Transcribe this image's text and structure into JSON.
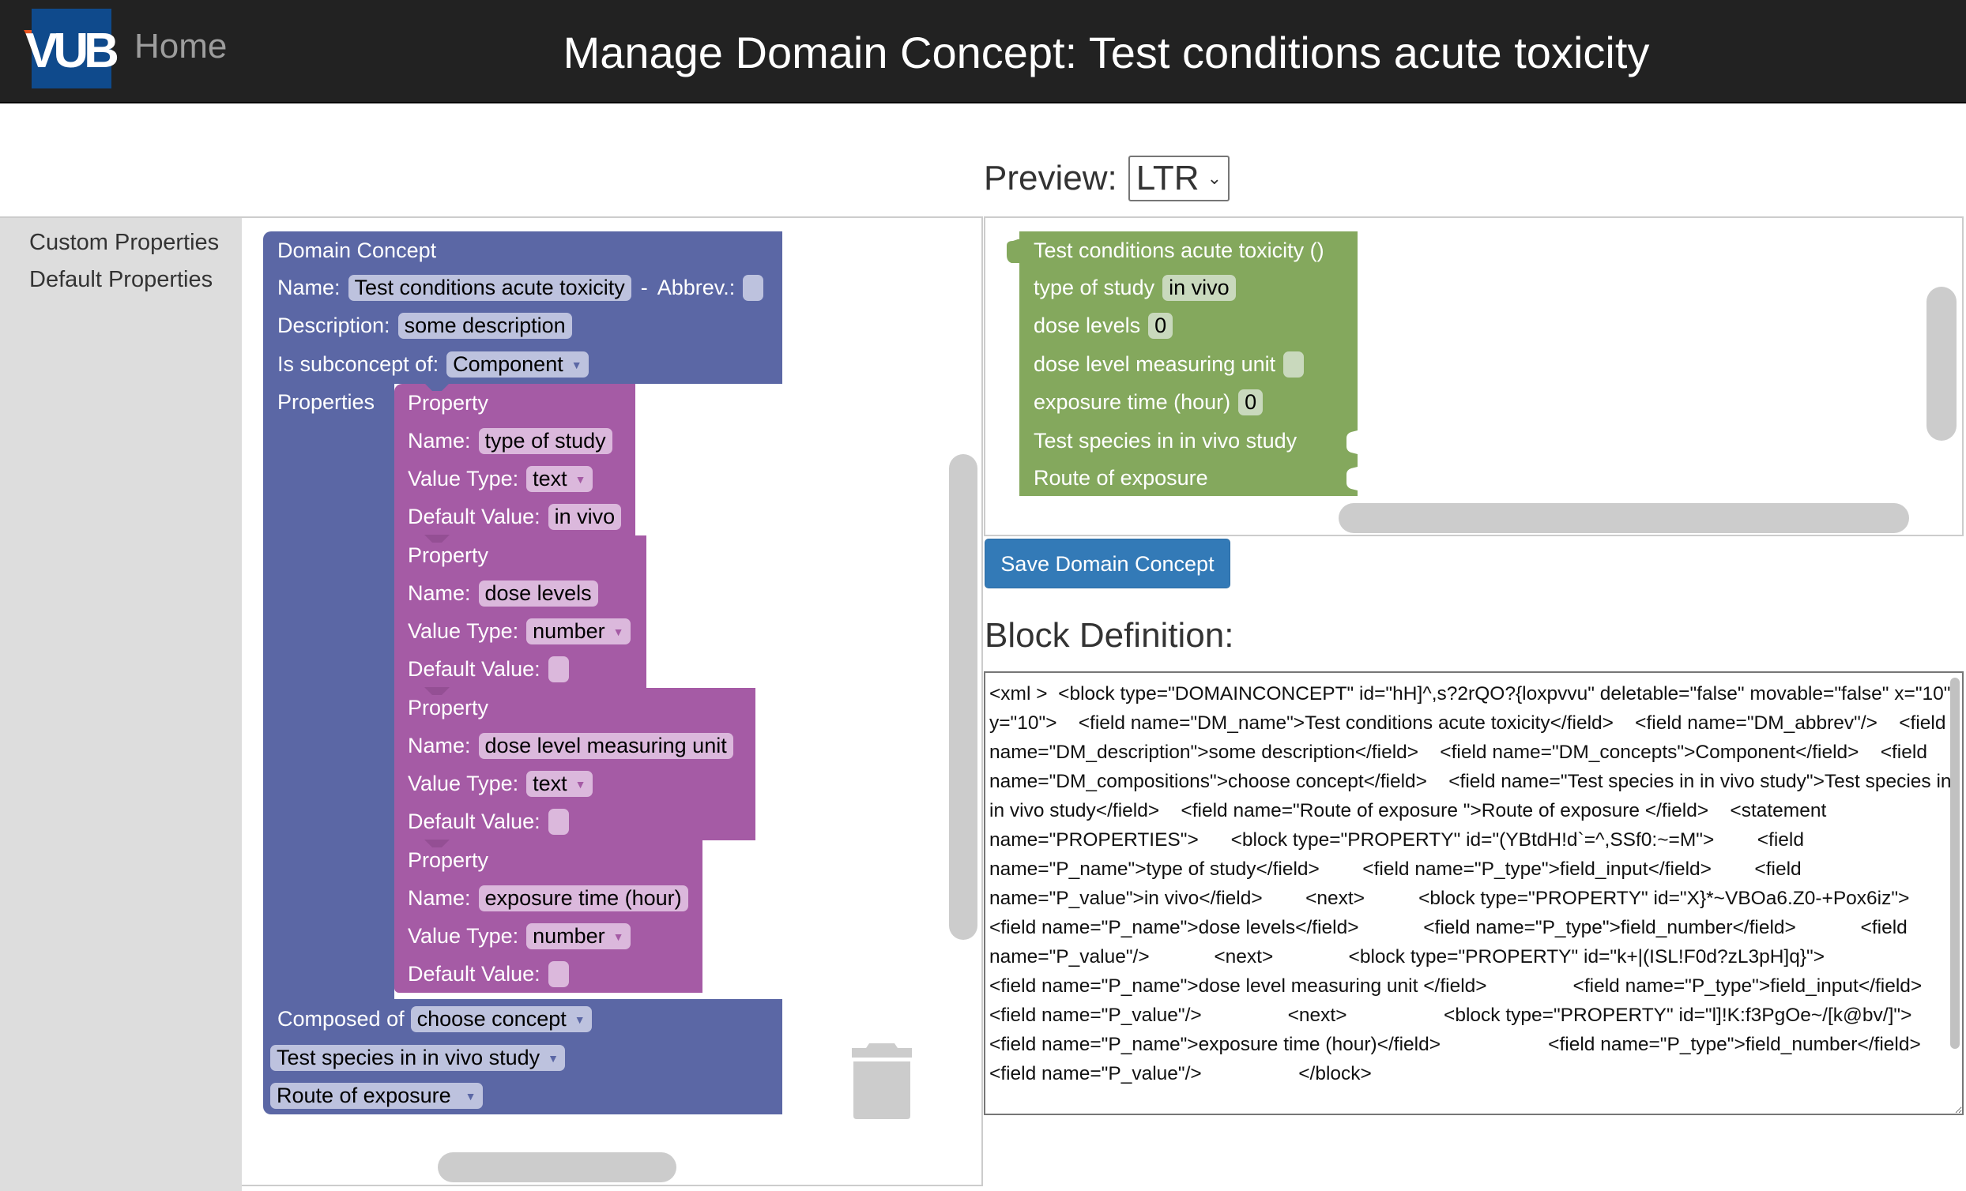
{
  "header": {
    "logo_text": "VUB",
    "home_label": "Home",
    "title": "Manage Domain Concept: Test conditions acute toxicity"
  },
  "preview": {
    "label": "Preview:",
    "selected": "LTR"
  },
  "sidebar": {
    "items": [
      {
        "label": "Custom Properties"
      },
      {
        "label": "Default Properties"
      }
    ]
  },
  "domain_concept_block": {
    "title": "Domain Concept",
    "name_label": "Name:",
    "name_value": "Test conditions acute toxicity",
    "separator": "-",
    "abbrev_label": "Abbrev.:",
    "abbrev_value": "",
    "description_label": "Description:",
    "description_value": "some description",
    "subconcept_label": "Is subconcept of:",
    "subconcept_value": "Component",
    "properties_label": "Properties",
    "composed_label": "Composed of",
    "composed_value": "choose concept",
    "compositions": [
      "Test species in in vivo study",
      "Route of exposure"
    ]
  },
  "property_blocks": [
    {
      "title": "Property",
      "name_label": "Name:",
      "name": "type of study",
      "type_label": "Value Type:",
      "type": "text",
      "default_label": "Default Value:",
      "default": "in vivo"
    },
    {
      "title": "Property",
      "name_label": "Name:",
      "name": "dose levels",
      "type_label": "Value Type:",
      "type": "number",
      "default_label": "Default Value:",
      "default": ""
    },
    {
      "title": "Property",
      "name_label": "Name:",
      "name": "dose level measuring unit",
      "type_label": "Value Type:",
      "type": "text",
      "default_label": "Default Value:",
      "default": ""
    },
    {
      "title": "Property",
      "name_label": "Name:",
      "name": "exposure time (hour)",
      "type_label": "Value Type:",
      "type": "number",
      "default_label": "Default Value:",
      "default": ""
    }
  ],
  "preview_block": {
    "title": "Test conditions acute toxicity ()",
    "rows": [
      {
        "label": "type of study",
        "value": "in vivo"
      },
      {
        "label": "dose levels",
        "value": "0"
      },
      {
        "label": "dose level measuring unit",
        "value": ""
      },
      {
        "label": "exposure time (hour)",
        "value": "0"
      }
    ],
    "inputs": [
      "Test species in in vivo study",
      "Route of exposure"
    ]
  },
  "save_button": "Save Domain Concept",
  "block_definition": {
    "heading": "Block Definition:",
    "xml": "<xml >  <block type=\"DOMAINCONCEPT\" id=\"hH]^,s?2rQO?{loxpvvu\" deletable=\"false\" movable=\"false\" x=\"10\" y=\"10\">    <field name=\"DM_name\">Test conditions acute toxicity</field>    <field name=\"DM_abbrev\"/>    <field name=\"DM_description\">some description</field>    <field name=\"DM_concepts\">Component</field>    <field name=\"DM_compositions\">choose concept</field>    <field name=\"Test species in in vivo study\">Test species in in vivo study</field>    <field name=\"Route of exposure \">Route of exposure </field>    <statement name=\"PROPERTIES\">      <block type=\"PROPERTY\" id=\"(YBtdH!d`=^,SSf0:~=M\">        <field name=\"P_name\">type of study</field>        <field name=\"P_type\">field_input</field>        <field name=\"P_value\">in vivo</field>        <next>          <block type=\"PROPERTY\" id=\"X}*~VBOa6.Z0-+Pox6iz\">            <field name=\"P_name\">dose levels</field>            <field name=\"P_type\">field_number</field>            <field name=\"P_value\"/>            <next>              <block type=\"PROPERTY\" id=\"k+|(ISL!F0d?zL3pH]q}\">                <field name=\"P_name\">dose level measuring unit </field>                <field name=\"P_type\">field_input</field>                <field name=\"P_value\"/>                <next>                  <block type=\"PROPERTY\" id=\"l]!K:f3PgOe~/[k@bv/]\">                    <field name=\"P_name\">exposure time (hour)</field>                    <field name=\"P_type\">field_number</field>                    <field name=\"P_value\"/>                  </block>"
  },
  "colors": {
    "header_bg": "#222222",
    "domain_block": "#5b67a5",
    "property_block": "#a55ba5",
    "preview_block": "#84a85d",
    "save_button": "#337ab7"
  }
}
